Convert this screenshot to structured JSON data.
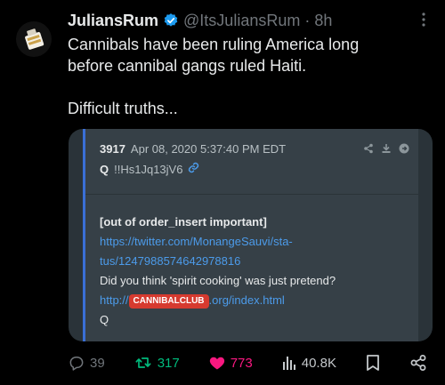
{
  "tweet": {
    "author_name": "JuliansRum",
    "handle": "@ItsJuliansRum",
    "separator": "·",
    "time": "8h",
    "lines": [
      "Cannibals have been ruling America long",
      "before cannibal gangs ruled Haiti.",
      "Difficult truths..."
    ]
  },
  "quoted_post": {
    "number": "3917",
    "date": "Apr 08, 2020 5:37:40 PM EDT",
    "q_label": "Q",
    "trip": "!!Hs1Jq13jV6",
    "bold_line": "[out of order_insert important]",
    "link_line_1": "https://twitter.com/MonangeSauvi/sta-",
    "link_line_2": "tus/1247988574642978816",
    "question": "Did you think 'spirit cooking' was just pretend?",
    "url_prefix": "http://",
    "url_tag": "CANNIBALCLUB",
    "url_suffix": ".org/index.html",
    "signature": "Q"
  },
  "actions": {
    "replies": "39",
    "retweets": "317",
    "likes": "773",
    "views": "40.8K"
  },
  "colors": {
    "verified": "#1d9bf0",
    "retweet": "#00ba7c",
    "like": "#f91880",
    "link": "#4c9bea",
    "tag": "#d63a2f"
  }
}
